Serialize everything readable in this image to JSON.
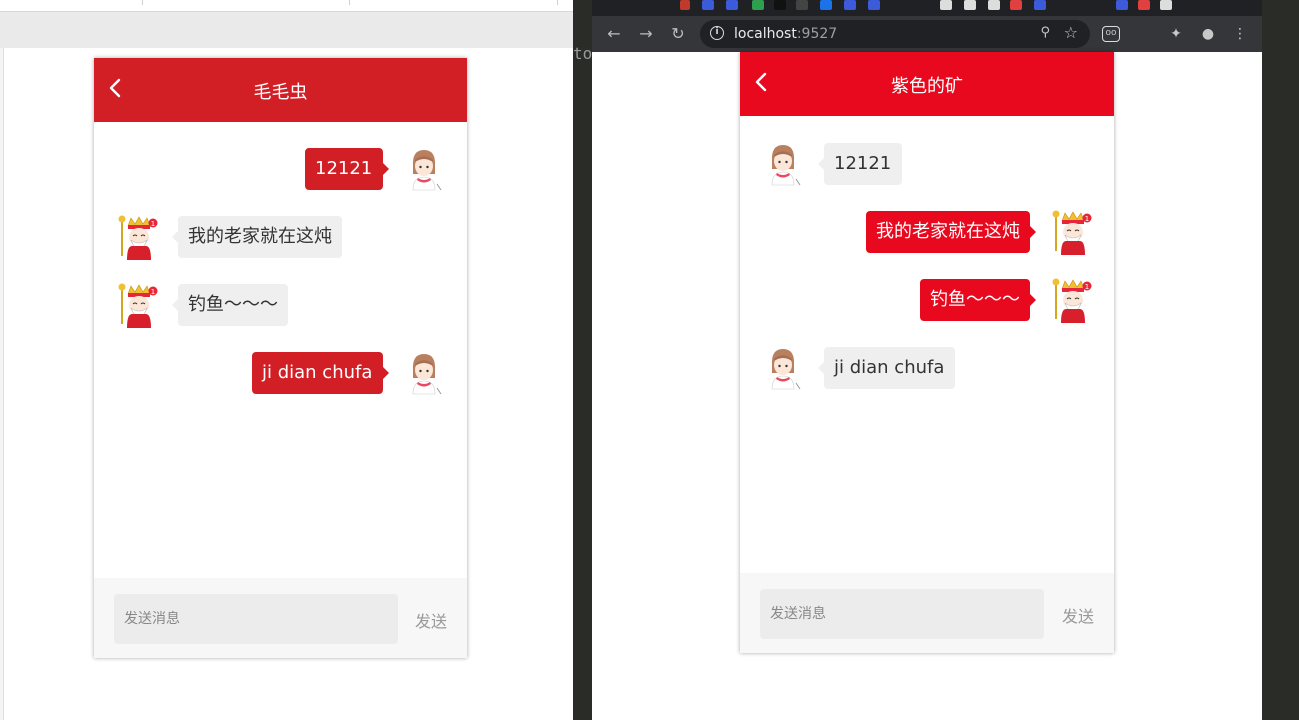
{
  "left_chat": {
    "title": "毛毛虫",
    "accent": "#d21f26",
    "messages": [
      {
        "text": "12121",
        "side": "right",
        "avatar": "girl"
      },
      {
        "text": "我的老家就在这炖",
        "side": "left",
        "avatar": "god-of-wealth"
      },
      {
        "text": "钓鱼～～～",
        "side": "left",
        "avatar": "god-of-wealth"
      },
      {
        "text": "ji dian chufa",
        "side": "right",
        "avatar": "girl"
      }
    ],
    "input_placeholder": "发送消息",
    "send_label": "发送"
  },
  "right_chat": {
    "title": "紫色的矿",
    "accent": "#e8091e",
    "messages": [
      {
        "text": "12121",
        "side": "left",
        "avatar": "girl"
      },
      {
        "text": "我的老家就在这炖",
        "side": "right",
        "avatar": "god-of-wealth"
      },
      {
        "text": "钓鱼～～～",
        "side": "right",
        "avatar": "god-of-wealth"
      },
      {
        "text": "ji dian chufa",
        "side": "left",
        "avatar": "girl"
      }
    ],
    "input_placeholder": "发送消息",
    "send_label": "发送"
  },
  "browser": {
    "url_host": "localhost",
    "url_port": ":9527"
  },
  "terminal": {
    "fragment": "to"
  },
  "colors": {
    "browser_chrome": "#35363a",
    "browser_tabstrip": "#202124",
    "terminal_bg": "#2a2c28"
  }
}
